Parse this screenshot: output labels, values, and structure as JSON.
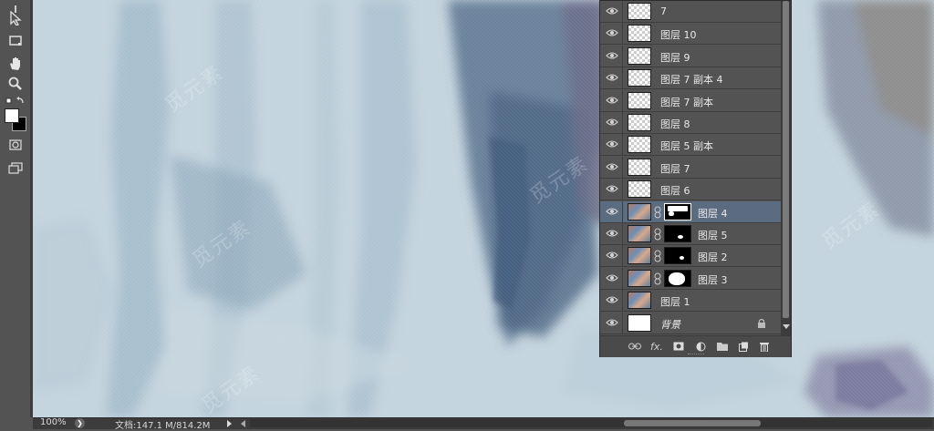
{
  "toolbar": {
    "tools": [
      {
        "name": "ruler-tool",
        "icon": "ruler-icon"
      },
      {
        "name": "path-selection-tool",
        "icon": "arrow-pointer-icon"
      },
      {
        "name": "rectangle-tool",
        "icon": "rectangle-icon"
      },
      {
        "name": "hand-tool",
        "icon": "hand-icon"
      },
      {
        "name": "zoom-tool",
        "icon": "magnifier-icon"
      },
      {
        "name": "quick-mask-tool",
        "icon": "quick-mask-icon"
      },
      {
        "name": "screen-mode-tool",
        "icon": "screen-mode-icon"
      }
    ],
    "foreground_color": "#ffffff",
    "background_color": "#000000"
  },
  "canvas": {
    "watermark": "觅元素"
  },
  "layers_panel": {
    "layers": [
      {
        "name": "7",
        "thumb": "transparent",
        "mask": false,
        "selected": false
      },
      {
        "name": "图层 10",
        "thumb": "transparent",
        "mask": false,
        "selected": false
      },
      {
        "name": "图层 9",
        "thumb": "transparent",
        "mask": false,
        "selected": false
      },
      {
        "name": "图层 7 副本 4",
        "thumb": "transparent",
        "mask": false,
        "selected": false
      },
      {
        "name": "图层 7 副本",
        "thumb": "transparent",
        "mask": false,
        "selected": false
      },
      {
        "name": "图层 8",
        "thumb": "transparent",
        "mask": false,
        "selected": false
      },
      {
        "name": "图层 5 副本",
        "thumb": "transparent",
        "mask": false,
        "selected": false
      },
      {
        "name": "图层 7",
        "thumb": "transparent",
        "mask": false,
        "selected": false
      },
      {
        "name": "图层 6",
        "thumb": "transparent",
        "mask": false,
        "selected": false
      },
      {
        "name": "图层 4",
        "thumb": "photo",
        "mask": true,
        "selected": true
      },
      {
        "name": "图层 5",
        "thumb": "photo",
        "mask": true,
        "selected": false
      },
      {
        "name": "图层 2",
        "thumb": "photo",
        "mask": true,
        "selected": false
      },
      {
        "name": "图层 3",
        "thumb": "photo",
        "mask": true,
        "selected": false
      },
      {
        "name": "图层 1",
        "thumb": "photo",
        "mask": false,
        "selected": false
      },
      {
        "name": "背景",
        "thumb": "white",
        "mask": false,
        "selected": false,
        "locked": true
      }
    ],
    "footer_buttons": [
      {
        "name": "link-layers-button",
        "icon": "link-icon",
        "label": "⚭"
      },
      {
        "name": "layer-style-button",
        "icon": "fx-icon",
        "label": "fx."
      },
      {
        "name": "add-mask-button",
        "icon": "mask-icon",
        "label": ""
      },
      {
        "name": "adjustment-layer-button",
        "icon": "half-circle-icon",
        "label": ""
      },
      {
        "name": "new-group-button",
        "icon": "folder-icon",
        "label": ""
      },
      {
        "name": "new-layer-button",
        "icon": "new-layer-icon",
        "label": ""
      },
      {
        "name": "delete-layer-button",
        "icon": "trash-icon",
        "label": ""
      }
    ]
  },
  "status_bar": {
    "zoom": "100%",
    "doc_info": "文档:147.1 M/814.2M"
  }
}
